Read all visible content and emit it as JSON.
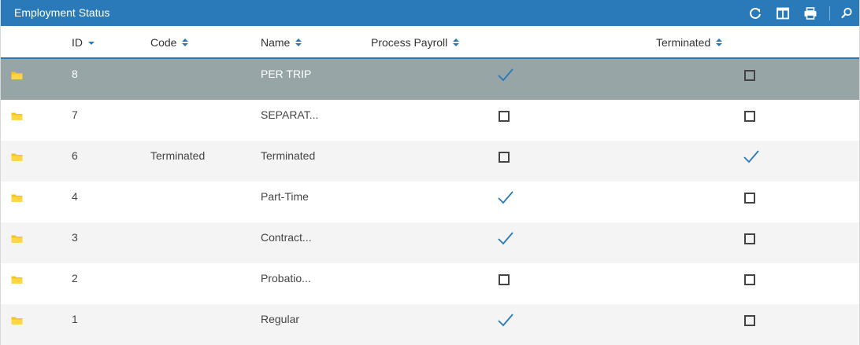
{
  "panel": {
    "title": "Employment Status",
    "toolbar": [
      "refresh-icon",
      "columns-icon",
      "print-icon",
      "search-icon"
    ]
  },
  "colors": {
    "header_bg": "#2a7ab9",
    "selected_row": "#97a5a6",
    "folder": "#f5c518",
    "check": "#2a7ab9"
  },
  "columns": [
    {
      "label": "ID",
      "sort": "descending"
    },
    {
      "label": "Code",
      "sort": "none"
    },
    {
      "label": "Name",
      "sort": "none"
    },
    {
      "label": "Process Payroll",
      "sort": "none"
    },
    {
      "label": "Terminated",
      "sort": "none"
    }
  ],
  "rows": [
    {
      "id": "8",
      "code": "",
      "name": "PER TRIP",
      "process_payroll": true,
      "terminated": false,
      "selected": true
    },
    {
      "id": "7",
      "code": "",
      "name": "SEPARAT...",
      "process_payroll": false,
      "terminated": false,
      "selected": false
    },
    {
      "id": "6",
      "code": "Terminated",
      "name": "Terminated",
      "process_payroll": false,
      "terminated": true,
      "selected": false
    },
    {
      "id": "4",
      "code": "",
      "name": "Part-Time",
      "process_payroll": true,
      "terminated": false,
      "selected": false
    },
    {
      "id": "3",
      "code": "",
      "name": "Contract...",
      "process_payroll": true,
      "terminated": false,
      "selected": false
    },
    {
      "id": "2",
      "code": "",
      "name": "Probatio...",
      "process_payroll": false,
      "terminated": false,
      "selected": false
    },
    {
      "id": "1",
      "code": "",
      "name": "Regular",
      "process_payroll": true,
      "terminated": false,
      "selected": false
    }
  ]
}
